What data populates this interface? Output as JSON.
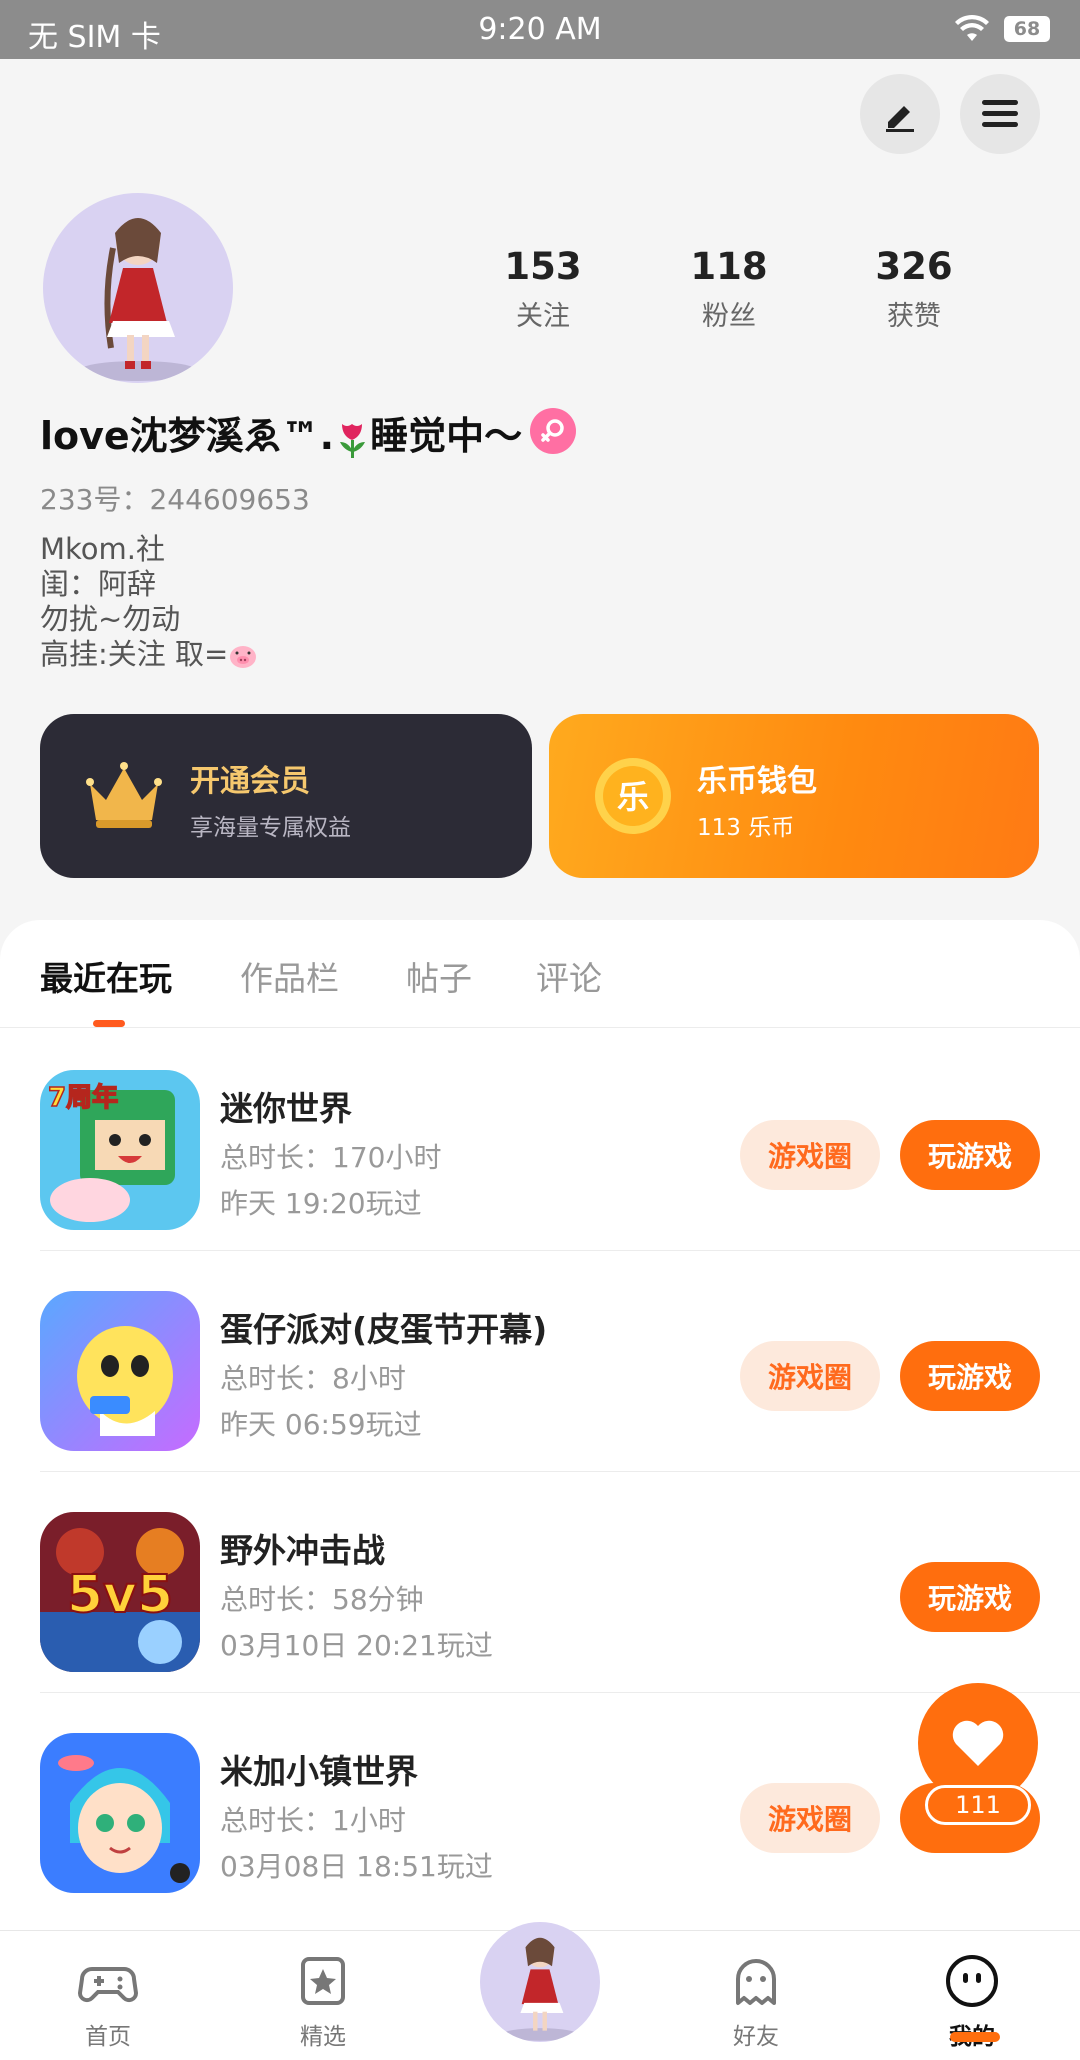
{
  "status_bar": {
    "carrier": "无 SIM 卡",
    "time": "9:20 AM",
    "battery": "68"
  },
  "profile": {
    "stats": [
      {
        "value": "153",
        "label": "关注"
      },
      {
        "value": "118",
        "label": "粉丝"
      },
      {
        "value": "326",
        "label": "获赞"
      }
    ],
    "nickname_prefix": "love沈梦溪ゑ™.",
    "nickname_suffix": "睡觉中～",
    "uid": "233号：244609653",
    "bio": [
      "Mkom.社",
      "闺：阿辞",
      "勿扰~勿动",
      "高挂:关注 取="
    ]
  },
  "cards": {
    "vip": {
      "title": "开通会员",
      "subtitle": "享海量专属权益"
    },
    "wallet": {
      "title": "乐币钱包",
      "subtitle": "113 乐币",
      "coin_char": "乐"
    }
  },
  "tabs": [
    "最近在玩",
    "作品栏",
    "帖子",
    "评论"
  ],
  "games": [
    {
      "name": "迷你世界",
      "duration": "总时长：170小时",
      "last_played": "昨天 19:20玩过",
      "circle_label": "游戏圈",
      "play_label": "玩游戏"
    },
    {
      "name": "蛋仔派对(皮蛋节开幕)",
      "duration": "总时长：8小时",
      "last_played": "昨天 06:59玩过",
      "circle_label": "游戏圈",
      "play_label": "玩游戏"
    },
    {
      "name": "野外冲击战",
      "duration": "总时长：58分钟",
      "last_played": "03月10日 20:21玩过",
      "play_label": "玩游戏"
    },
    {
      "name": "米加小镇世界",
      "duration": "总时长：1小时",
      "last_played": "03月08日 18:51玩过",
      "circle_label": "游戏圈"
    }
  ],
  "game_icon_text": {
    "mini_world": "7周年",
    "wild": "5v5"
  },
  "fab": {
    "count": "111"
  },
  "bottom_nav": [
    {
      "label": "首页",
      "icon": "gamepad-icon"
    },
    {
      "label": "精选",
      "icon": "star-bookmark-icon"
    },
    {
      "label": "好友",
      "icon": "ghost-icon"
    },
    {
      "label": "我的",
      "icon": "smiley-icon"
    }
  ],
  "colors": {
    "accent": "#ff6e0e",
    "vip_card": "#2c2b36",
    "gold": "#f6c86e"
  }
}
